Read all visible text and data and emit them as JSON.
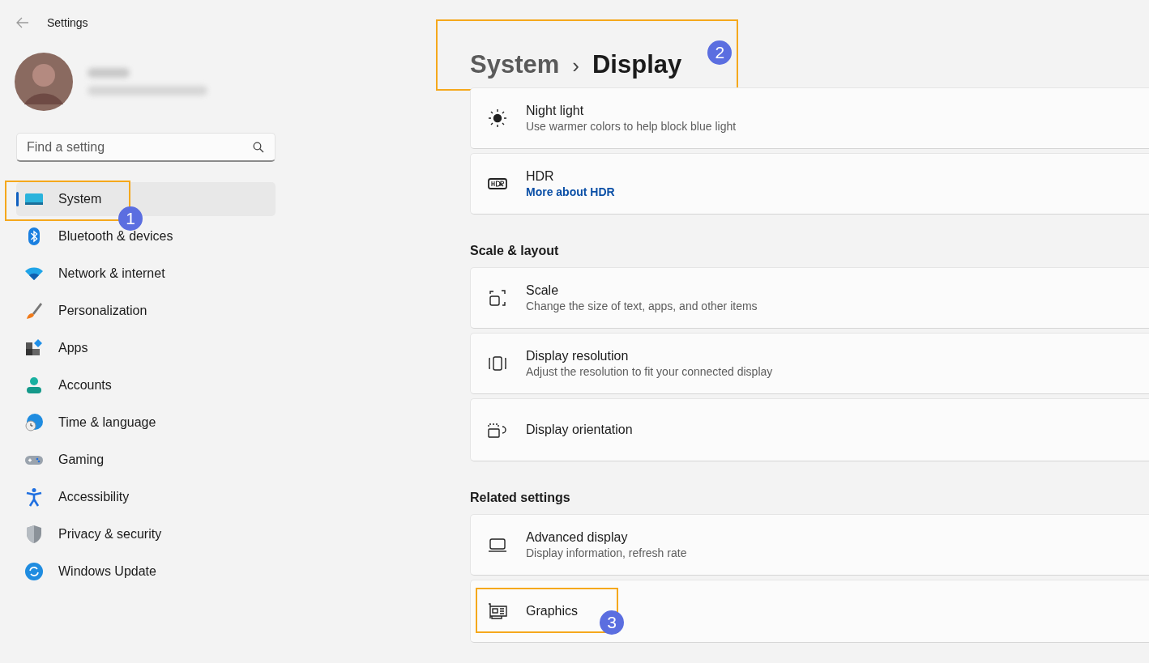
{
  "window": {
    "title": "Settings"
  },
  "search": {
    "placeholder": "Find a setting"
  },
  "sidebar": {
    "items": [
      {
        "label": "System",
        "selected": true,
        "callout": "1"
      },
      {
        "label": "Bluetooth & devices",
        "selected": false
      },
      {
        "label": "Network & internet",
        "selected": false
      },
      {
        "label": "Personalization",
        "selected": false
      },
      {
        "label": "Apps",
        "selected": false
      },
      {
        "label": "Accounts",
        "selected": false
      },
      {
        "label": "Time & language",
        "selected": false
      },
      {
        "label": "Gaming",
        "selected": false
      },
      {
        "label": "Accessibility",
        "selected": false
      },
      {
        "label": "Privacy & security",
        "selected": false
      },
      {
        "label": "Windows Update",
        "selected": false
      }
    ]
  },
  "breadcrumb": {
    "parent": "System",
    "separator": "›",
    "current": "Display",
    "callout": "2"
  },
  "sections": [
    {
      "cards": [
        {
          "title": "Night light",
          "subtitle": "Use warmer colors to help block blue light"
        },
        {
          "title": "HDR",
          "link": "More about HDR"
        }
      ]
    },
    {
      "heading": "Scale & layout",
      "cards": [
        {
          "title": "Scale",
          "subtitle": "Change the size of text, apps, and other items"
        },
        {
          "title": "Display resolution",
          "subtitle": "Adjust the resolution to fit your connected display"
        },
        {
          "title": "Display orientation"
        }
      ]
    },
    {
      "heading": "Related settings",
      "cards": [
        {
          "title": "Advanced display",
          "subtitle": "Display information, refresh rate"
        },
        {
          "title": "Graphics",
          "callout": "3"
        }
      ]
    }
  ]
}
